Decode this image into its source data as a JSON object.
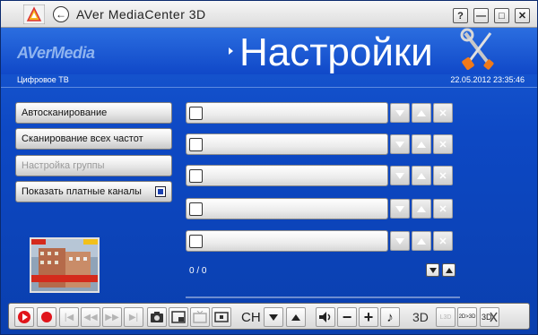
{
  "app": {
    "title": "AVer MediaCenter 3D",
    "logo_text": "AVerMedia",
    "page_title": "Настройки",
    "section": "Цифровое ТВ",
    "datetime": "22.05.2012 23:35:46"
  },
  "window_controls": {
    "help": "?",
    "minimize": "—",
    "maximize": "□",
    "close": "✕"
  },
  "menu": {
    "autoscan": "Автосканирование",
    "scan_all": "Сканирование всех частот",
    "group_settings": "Настройка группы",
    "show_paid": "Показать платные каналы"
  },
  "channels": [
    {
      "name": "",
      "checked": false
    },
    {
      "name": "",
      "checked": false
    },
    {
      "name": "",
      "checked": false
    },
    {
      "name": "",
      "checked": false
    },
    {
      "name": "",
      "checked": false
    }
  ],
  "pager": {
    "text": "0 / 0"
  },
  "toolbar": {
    "ch_label": "CH",
    "three_d_label": "3D",
    "mode_2d3d": "2D>3D",
    "mode_l3d": "L3D",
    "mode_3d": "3D"
  },
  "colors": {
    "background": "#0d48c4",
    "record": "#e0151b",
    "accent": "#1a3fb0"
  },
  "icons": [
    "back-icon",
    "tools-icon",
    "play-icon",
    "record-icon",
    "screenshot-icon",
    "volume-icon",
    "music-note-icon"
  ]
}
